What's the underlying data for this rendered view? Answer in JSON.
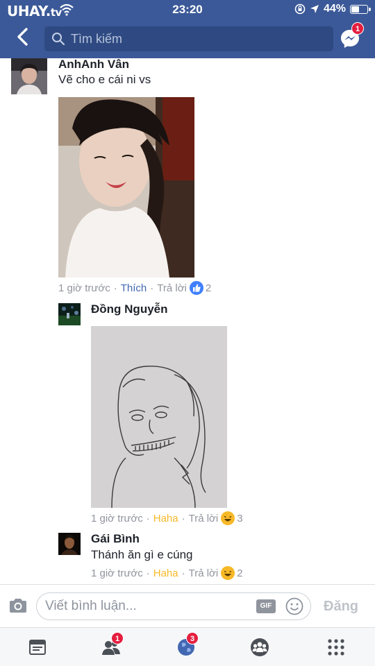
{
  "status_bar": {
    "watermark": "UHAY.",
    "watermark_suffix": "tv",
    "time": "23:20",
    "battery": "44%"
  },
  "search": {
    "placeholder": "Tìm kiếm"
  },
  "messenger": {
    "badge": "1"
  },
  "comments": [
    {
      "name": "AnhAnh Vân",
      "text": "Vẽ cho e cái ni vs",
      "time": "1 giờ trước",
      "reaction_label": "Thích",
      "reply": "Trả lời",
      "reaction_icon": "like-icon",
      "reaction_count": "2"
    },
    {
      "name": "Đồng Nguyễn",
      "text": "",
      "time": "1 giờ trước",
      "reaction_label": "Haha",
      "reply": "Trả lời",
      "reaction_icon": "haha-icon",
      "reaction_count": "3"
    },
    {
      "name": "Gái Bình",
      "text": "Thánh ăn gì e cúng",
      "time": "1 giờ trước",
      "reaction_label": "Haha",
      "reply": "Trả lời",
      "reaction_icon": "haha-icon",
      "reaction_count": "2"
    }
  ],
  "composer": {
    "placeholder": "Viết bình luận...",
    "gif_label": "GIF",
    "post_label": "Đăng"
  },
  "tabs": [
    {
      "icon": "news-feed-icon",
      "badge": ""
    },
    {
      "icon": "friend-requests-icon",
      "badge": "1"
    },
    {
      "icon": "notifications-globe-icon",
      "badge": "3"
    },
    {
      "icon": "groups-icon",
      "badge": ""
    },
    {
      "icon": "menu-grid-icon",
      "badge": ""
    }
  ],
  "colors": {
    "header": "#3b5998",
    "like": "#4267b2",
    "haha": "#f7b928",
    "badge": "#e41e3f",
    "meta": "#90949c"
  }
}
